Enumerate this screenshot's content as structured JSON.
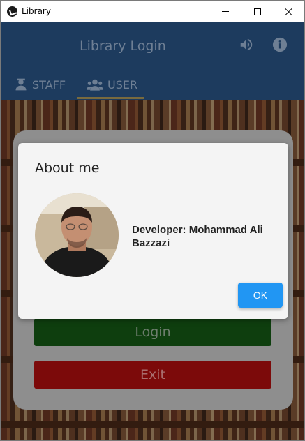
{
  "window": {
    "title": "Library"
  },
  "header": {
    "title": "Library Login",
    "icons": [
      "speaker-icon",
      "info-icon"
    ],
    "background": "#1d3b5e"
  },
  "tabs": [
    {
      "label": "STAFF",
      "icon": "staff-icon",
      "selected": false
    },
    {
      "label": "USER",
      "icon": "users-icon",
      "selected": true
    }
  ],
  "login_card": {
    "login_label": "Login",
    "exit_label": "Exit",
    "login_color": "#0e3e0e",
    "exit_color": "#7c0a0a"
  },
  "dialog": {
    "title": "About me",
    "developer_text": "Developer: Mohammad Ali Bazzazi",
    "ok_label": "OK",
    "ok_color": "#2196f3"
  }
}
